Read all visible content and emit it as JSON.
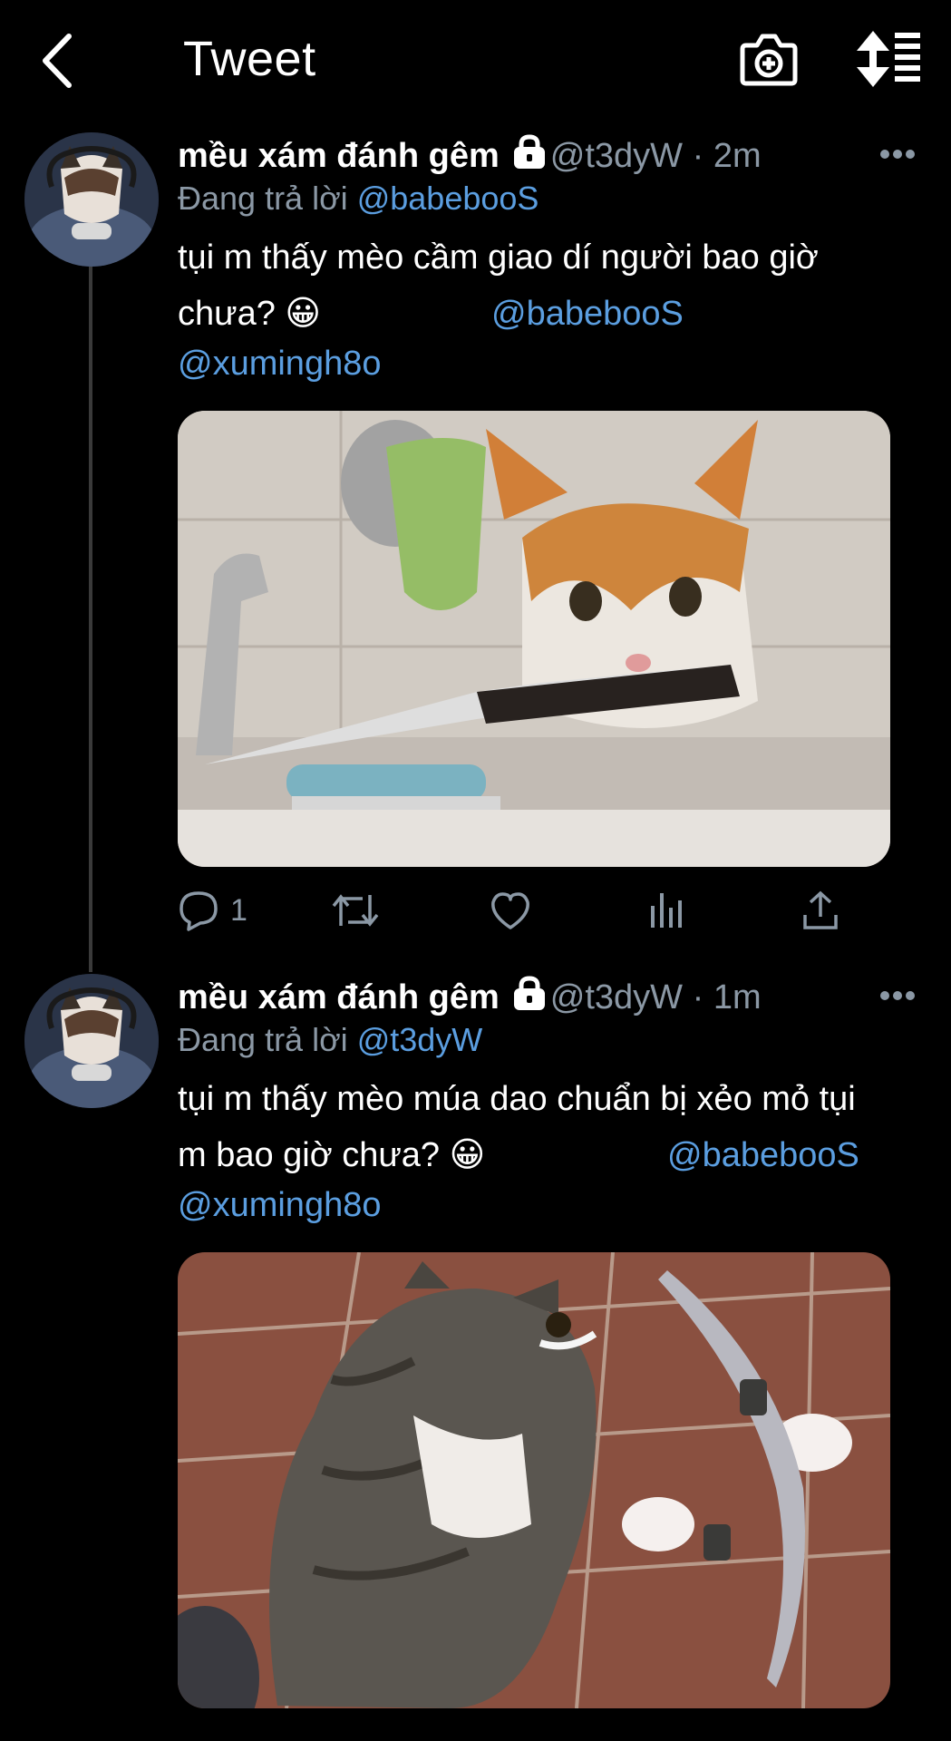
{
  "header": {
    "title": "Tweet",
    "back_icon": "chevron-left-icon",
    "camera_icon": "camera-plus-icon",
    "sort_icon": "sort-icon"
  },
  "tweets": [
    {
      "name": "mều xám đánh gêm",
      "handle": "@t3dyW",
      "sep": " · ",
      "time": "2m",
      "reply_prefix": "Đang trả lời",
      "reply_to": "@babebooS",
      "text_line1": "tụi m thấy mèo cầm giao dí người bao giờ",
      "text_line2": "chưa? 😀",
      "mention_a": "@babebooS",
      "mention_b": "@xumingh8o",
      "reply_count": "1",
      "media_alt": "orange-white cat holding knife in mouth at sink"
    },
    {
      "name": "mều xám đánh gêm",
      "handle": "@t3dyW",
      "sep": " · ",
      "time": "1m",
      "reply_prefix": "Đang trả lời",
      "reply_to": "@t3dyW",
      "text_line1": "tụi m thấy mèo múa dao chuẩn bị xẻo mỏ tụi",
      "text_line2": "m bao giờ chưa? 😀",
      "mention_a": "@babebooS",
      "mention_b": "@xumingh8o",
      "media_alt": "tabby cat holding double-bladed knife"
    }
  ],
  "colors": {
    "background": "#000000",
    "secondary_text": "#8b98a5",
    "link": "#5b9ee0"
  }
}
